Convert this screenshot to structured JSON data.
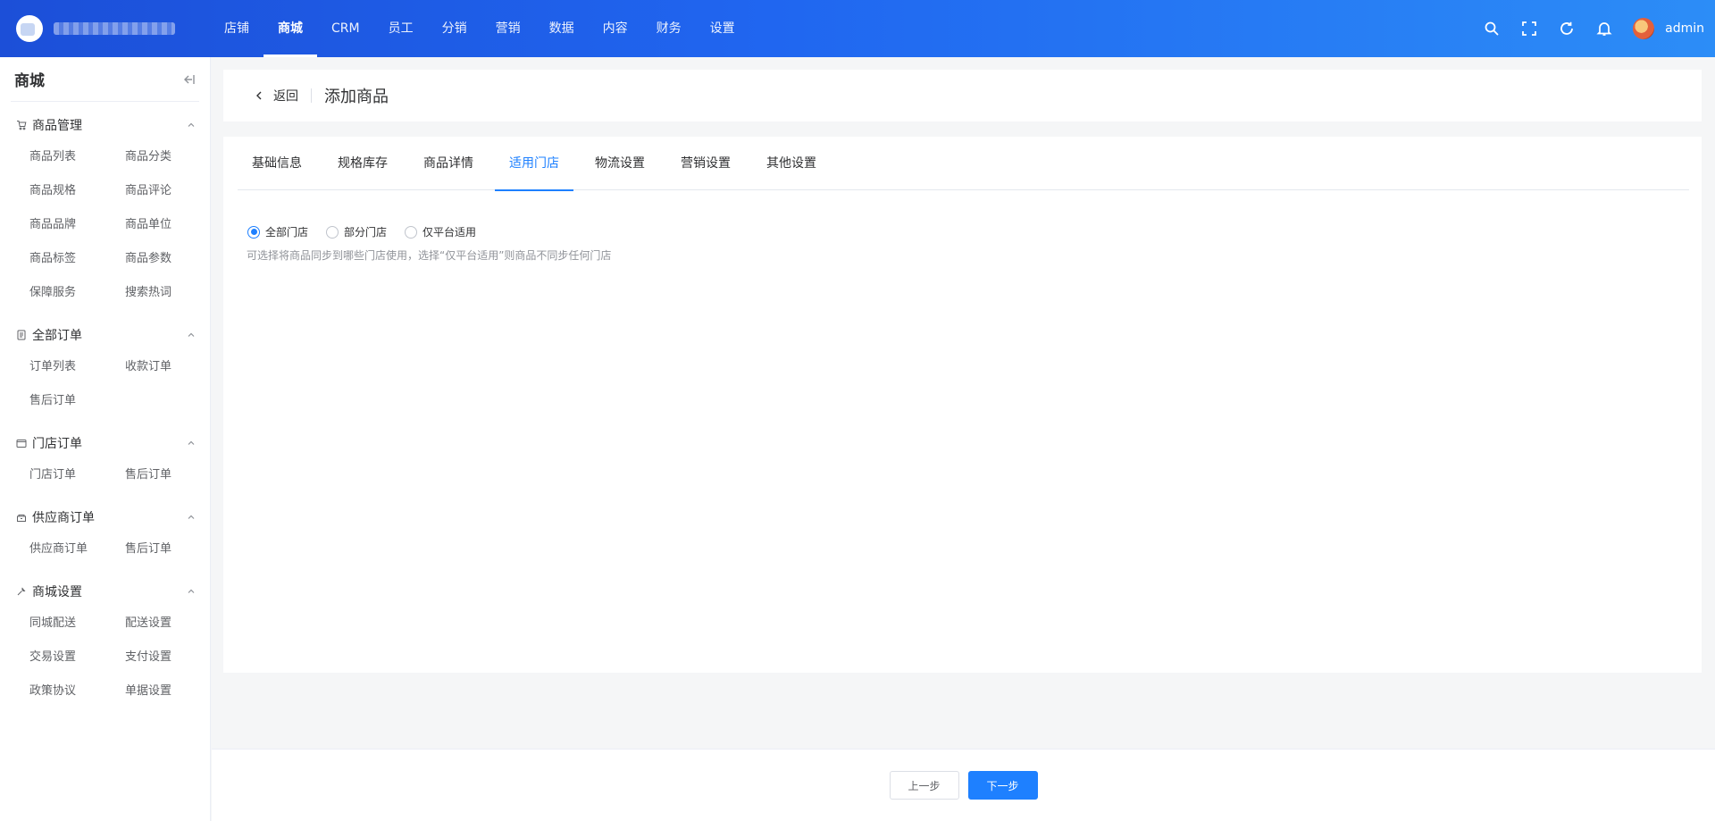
{
  "topbar": {
    "nav": [
      "店铺",
      "商城",
      "CRM",
      "员工",
      "分销",
      "营销",
      "数据",
      "内容",
      "财务",
      "设置"
    ],
    "active_nav": "商城",
    "username": "admin",
    "icons": [
      "search-icon",
      "fullscreen-icon",
      "refresh-icon",
      "bell-icon"
    ]
  },
  "sidebar": {
    "title": "商城",
    "groups": [
      {
        "title": "商品管理",
        "icon": "cart-icon",
        "items": [
          "商品列表",
          "商品分类",
          "商品规格",
          "商品评论",
          "商品品牌",
          "商品单位",
          "商品标签",
          "商品参数",
          "保障服务",
          "搜索热词"
        ]
      },
      {
        "title": "全部订单",
        "icon": "document-icon",
        "items": [
          "订单列表",
          "收款订单",
          "售后订单"
        ]
      },
      {
        "title": "门店订单",
        "icon": "store-icon",
        "items": [
          "门店订单",
          "售后订单"
        ]
      },
      {
        "title": "供应商订单",
        "icon": "box-icon",
        "items": [
          "供应商订单",
          "售后订单"
        ]
      },
      {
        "title": "商城设置",
        "icon": "wrench-icon",
        "items": [
          "同城配送",
          "配送设置",
          "交易设置",
          "支付设置",
          "政策协议",
          "单据设置"
        ]
      }
    ]
  },
  "header": {
    "back_label": "返回",
    "title": "添加商品"
  },
  "tabs": [
    "基础信息",
    "规格库存",
    "商品详情",
    "适用门店",
    "物流设置",
    "营销设置",
    "其他设置"
  ],
  "active_tab": "适用门店",
  "store_scope": {
    "options": [
      "全部门店",
      "部分门店",
      "仅平台适用"
    ],
    "selected": "全部门店",
    "hint": "可选择将商品同步到哪些门店使用，选择“仅平台适用”则商品不同步任何门店"
  },
  "footer": {
    "prev_label": "上一步",
    "next_label": "下一步"
  },
  "colors": {
    "primary": "#1e80ff",
    "topbar_start": "#1c4fd8",
    "topbar_end": "#2c8df7"
  }
}
